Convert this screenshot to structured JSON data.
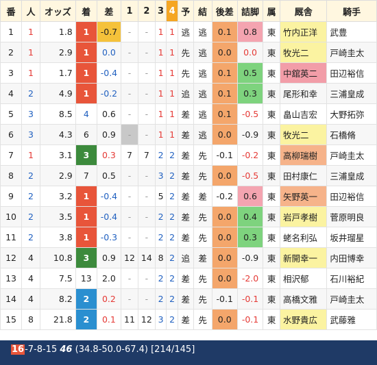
{
  "headers": [
    "番",
    "人",
    "オッズ",
    "着",
    "差",
    "1",
    "2",
    "3",
    "4",
    "予",
    "結",
    "後差",
    "詰脚",
    "属",
    "厩舎",
    "騎手"
  ],
  "rows": [
    {
      "ban": "1",
      "nin": "1",
      "odds": "1.8",
      "chaku": "1",
      "sa": "-0.7",
      "p1": "-",
      "p2": "-",
      "p3": "1",
      "p4": "1",
      "yo": "逃",
      "ketsu": "逃",
      "kosa": "0.1",
      "tsume": "0.8",
      "zoku": "東",
      "kyusha": "竹内正洋",
      "kishu": "武豊"
    },
    {
      "ban": "2",
      "nin": "1",
      "odds": "2.9",
      "chaku": "1",
      "sa": "0.0",
      "p1": "-",
      "p2": "-",
      "p3": "1",
      "p4": "1",
      "yo": "先",
      "ketsu": "逃",
      "kosa": "0.0",
      "tsume": "0.0",
      "zoku": "東",
      "kyusha": "牧光二",
      "kishu": "戸崎圭太"
    },
    {
      "ban": "3",
      "nin": "1",
      "odds": "1.7",
      "chaku": "1",
      "sa": "-0.4",
      "p1": "-",
      "p2": "-",
      "p3": "1",
      "p4": "1",
      "yo": "先",
      "ketsu": "逃",
      "kosa": "0.1",
      "tsume": "0.5",
      "zoku": "東",
      "kyusha": "中舘英二",
      "kishu": "田辺裕信"
    },
    {
      "ban": "4",
      "nin": "2",
      "odds": "4.9",
      "chaku": "1",
      "sa": "-0.2",
      "p1": "-",
      "p2": "-",
      "p3": "1",
      "p4": "1",
      "yo": "追",
      "ketsu": "逃",
      "kosa": "0.1",
      "tsume": "0.3",
      "zoku": "東",
      "kyusha": "尾形和幸",
      "kishu": "三浦皇成"
    },
    {
      "ban": "5",
      "nin": "3",
      "odds": "8.5",
      "chaku": "4",
      "sa": "0.6",
      "p1": "-",
      "p2": "-",
      "p3": "1",
      "p4": "1",
      "yo": "差",
      "ketsu": "逃",
      "kosa": "0.1",
      "tsume": "-0.5",
      "zoku": "東",
      "kyusha": "畠山吉宏",
      "kishu": "大野拓弥"
    },
    {
      "ban": "6",
      "nin": "3",
      "odds": "4.3",
      "chaku": "6",
      "sa": "0.9",
      "p1": "-",
      "p2": "-",
      "p3": "1",
      "p4": "1",
      "yo": "差",
      "ketsu": "逃",
      "kosa": "0.0",
      "tsume": "-0.9",
      "zoku": "東",
      "kyusha": "牧光二",
      "kishu": "石橋脩"
    },
    {
      "ban": "7",
      "nin": "1",
      "odds": "3.1",
      "chaku": "3",
      "sa": "0.3",
      "p1": "7",
      "p2": "7",
      "p3": "2",
      "p4": "2",
      "yo": "差",
      "ketsu": "先",
      "kosa": "-0.1",
      "tsume": "-0.2",
      "zoku": "東",
      "kyusha": "高柳瑞樹",
      "kishu": "戸崎圭太"
    },
    {
      "ban": "8",
      "nin": "2",
      "odds": "2.9",
      "chaku": "7",
      "sa": "0.5",
      "p1": "-",
      "p2": "-",
      "p3": "3",
      "p4": "2",
      "yo": "差",
      "ketsu": "先",
      "kosa": "0.0",
      "tsume": "-0.5",
      "zoku": "東",
      "kyusha": "田村康仁",
      "kishu": "三浦皇成"
    },
    {
      "ban": "9",
      "nin": "2",
      "odds": "3.2",
      "chaku": "1",
      "sa": "-0.4",
      "p1": "-",
      "p2": "-",
      "p3": "5",
      "p4": "2",
      "yo": "差",
      "ketsu": "差",
      "kosa": "-0.2",
      "tsume": "0.6",
      "zoku": "東",
      "kyusha": "矢野英一",
      "kishu": "田辺裕信"
    },
    {
      "ban": "10",
      "nin": "2",
      "odds": "3.5",
      "chaku": "1",
      "sa": "-0.4",
      "p1": "-",
      "p2": "-",
      "p3": "2",
      "p4": "2",
      "yo": "差",
      "ketsu": "先",
      "kosa": "0.0",
      "tsume": "0.4",
      "zoku": "東",
      "kyusha": "岩戸孝樹",
      "kishu": "菅原明良"
    },
    {
      "ban": "11",
      "nin": "2",
      "odds": "3.8",
      "chaku": "1",
      "sa": "-0.3",
      "p1": "-",
      "p2": "-",
      "p3": "2",
      "p4": "2",
      "yo": "差",
      "ketsu": "先",
      "kosa": "0.0",
      "tsume": "0.3",
      "zoku": "東",
      "kyusha": "蛯名利弘",
      "kishu": "坂井瑠星"
    },
    {
      "ban": "12",
      "nin": "4",
      "odds": "10.8",
      "chaku": "3",
      "sa": "0.9",
      "p1": "12",
      "p2": "14",
      "p3": "8",
      "p4": "2",
      "yo": "追",
      "ketsu": "差",
      "kosa": "0.0",
      "tsume": "-0.9",
      "zoku": "東",
      "kyusha": "新開幸一",
      "kishu": "内田博幸"
    },
    {
      "ban": "13",
      "nin": "4",
      "odds": "7.5",
      "chaku": "13",
      "sa": "2.0",
      "p1": "-",
      "p2": "-",
      "p3": "2",
      "p4": "2",
      "yo": "差",
      "ketsu": "先",
      "kosa": "0.0",
      "tsume": "-2.0",
      "zoku": "東",
      "kyusha": "相沢郁",
      "kishu": "石川裕紀"
    },
    {
      "ban": "14",
      "nin": "4",
      "odds": "8.2",
      "chaku": "2",
      "sa": "0.2",
      "p1": "-",
      "p2": "-",
      "p3": "2",
      "p4": "2",
      "yo": "差",
      "ketsu": "先",
      "kosa": "-0.1",
      "tsume": "-0.1",
      "zoku": "東",
      "kyusha": "高橋文雅",
      "kishu": "戸崎圭太"
    },
    {
      "ban": "15",
      "nin": "8",
      "odds": "21.8",
      "chaku": "2",
      "sa": "0.1",
      "p1": "11",
      "p2": "12",
      "p3": "3",
      "p4": "2",
      "yo": "差",
      "ketsu": "先",
      "kosa": "0.0",
      "tsume": "-0.1",
      "zoku": "東",
      "kyusha": "水野貴広",
      "kishu": "武藤雅"
    }
  ],
  "footer": {
    "lead": "16",
    "text1": "-7-8-15 ",
    "bold": "46",
    "text2": " (34.8-50.0-67.4) [214/145]"
  }
}
